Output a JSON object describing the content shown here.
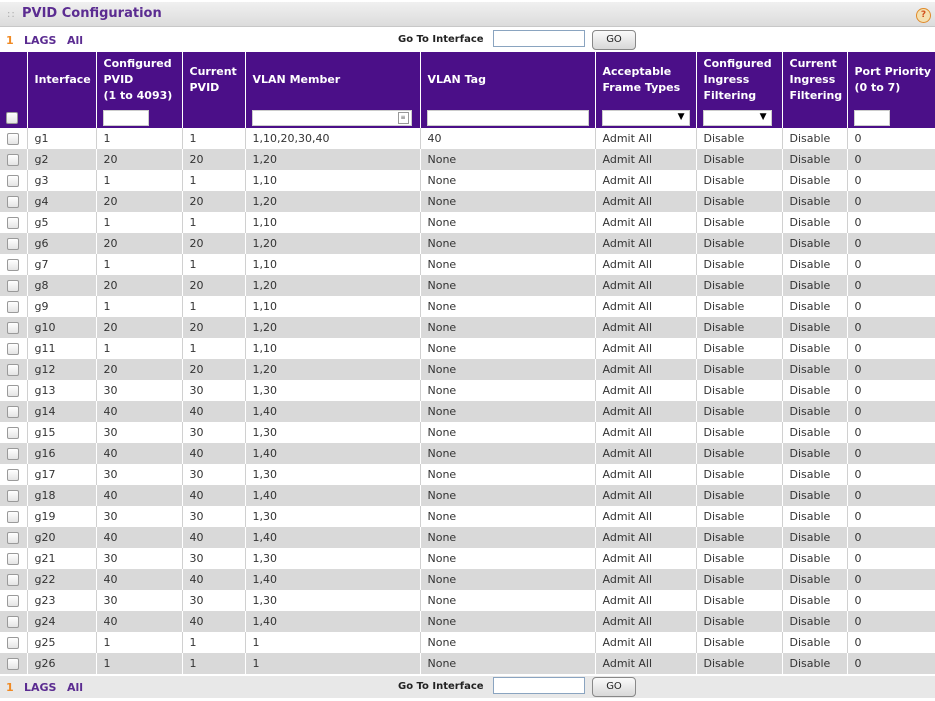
{
  "header": {
    "title": "PVID Configuration",
    "help_label": "?"
  },
  "nav": {
    "num": "1",
    "lags": "LAGS",
    "all": "All",
    "goto_label": "Go To Interface",
    "go_label": "GO"
  },
  "table": {
    "columns": [
      "Interface",
      "Configured PVID\n(1 to 4093)",
      "Current PVID",
      "VLAN Member",
      "VLAN Tag",
      "Acceptable Frame Types",
      "Configured Ingress Filtering",
      "Current Ingress Filtering",
      "Port Priority\n(0 to 7)"
    ],
    "rows": [
      [
        "g1",
        "1",
        "1",
        "1,10,20,30,40",
        "40",
        "Admit All",
        "Disable",
        "Disable",
        "0"
      ],
      [
        "g2",
        "20",
        "20",
        "1,20",
        "None",
        "Admit All",
        "Disable",
        "Disable",
        "0"
      ],
      [
        "g3",
        "1",
        "1",
        "1,10",
        "None",
        "Admit All",
        "Disable",
        "Disable",
        "0"
      ],
      [
        "g4",
        "20",
        "20",
        "1,20",
        "None",
        "Admit All",
        "Disable",
        "Disable",
        "0"
      ],
      [
        "g5",
        "1",
        "1",
        "1,10",
        "None",
        "Admit All",
        "Disable",
        "Disable",
        "0"
      ],
      [
        "g6",
        "20",
        "20",
        "1,20",
        "None",
        "Admit All",
        "Disable",
        "Disable",
        "0"
      ],
      [
        "g7",
        "1",
        "1",
        "1,10",
        "None",
        "Admit All",
        "Disable",
        "Disable",
        "0"
      ],
      [
        "g8",
        "20",
        "20",
        "1,20",
        "None",
        "Admit All",
        "Disable",
        "Disable",
        "0"
      ],
      [
        "g9",
        "1",
        "1",
        "1,10",
        "None",
        "Admit All",
        "Disable",
        "Disable",
        "0"
      ],
      [
        "g10",
        "20",
        "20",
        "1,20",
        "None",
        "Admit All",
        "Disable",
        "Disable",
        "0"
      ],
      [
        "g11",
        "1",
        "1",
        "1,10",
        "None",
        "Admit All",
        "Disable",
        "Disable",
        "0"
      ],
      [
        "g12",
        "20",
        "20",
        "1,20",
        "None",
        "Admit All",
        "Disable",
        "Disable",
        "0"
      ],
      [
        "g13",
        "30",
        "30",
        "1,30",
        "None",
        "Admit All",
        "Disable",
        "Disable",
        "0"
      ],
      [
        "g14",
        "40",
        "40",
        "1,40",
        "None",
        "Admit All",
        "Disable",
        "Disable",
        "0"
      ],
      [
        "g15",
        "30",
        "30",
        "1,30",
        "None",
        "Admit All",
        "Disable",
        "Disable",
        "0"
      ],
      [
        "g16",
        "40",
        "40",
        "1,40",
        "None",
        "Admit All",
        "Disable",
        "Disable",
        "0"
      ],
      [
        "g17",
        "30",
        "30",
        "1,30",
        "None",
        "Admit All",
        "Disable",
        "Disable",
        "0"
      ],
      [
        "g18",
        "40",
        "40",
        "1,40",
        "None",
        "Admit All",
        "Disable",
        "Disable",
        "0"
      ],
      [
        "g19",
        "30",
        "30",
        "1,30",
        "None",
        "Admit All",
        "Disable",
        "Disable",
        "0"
      ],
      [
        "g20",
        "40",
        "40",
        "1,40",
        "None",
        "Admit All",
        "Disable",
        "Disable",
        "0"
      ],
      [
        "g21",
        "30",
        "30",
        "1,30",
        "None",
        "Admit All",
        "Disable",
        "Disable",
        "0"
      ],
      [
        "g22",
        "40",
        "40",
        "1,40",
        "None",
        "Admit All",
        "Disable",
        "Disable",
        "0"
      ],
      [
        "g23",
        "30",
        "30",
        "1,30",
        "None",
        "Admit All",
        "Disable",
        "Disable",
        "0"
      ],
      [
        "g24",
        "40",
        "40",
        "1,40",
        "None",
        "Admit All",
        "Disable",
        "Disable",
        "0"
      ],
      [
        "g25",
        "1",
        "1",
        "1",
        "None",
        "Admit All",
        "Disable",
        "Disable",
        "0"
      ],
      [
        "g26",
        "1",
        "1",
        "1",
        "None",
        "Admit All",
        "Disable",
        "Disable",
        "0"
      ]
    ]
  },
  "colors": {
    "accent": "#4b0f88",
    "title": "#5b2c91",
    "row_alt": "#d9d9d9",
    "nav_num": "#f08a24"
  }
}
